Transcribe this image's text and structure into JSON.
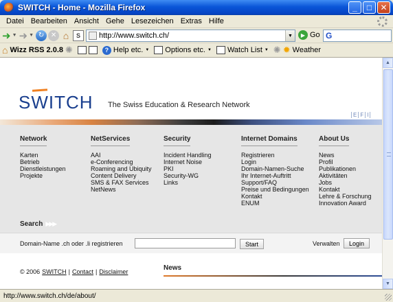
{
  "window": {
    "title": "SWITCH - Home - Mozilla Firefox"
  },
  "menu": [
    "Datei",
    "Bearbeiten",
    "Ansicht",
    "Gehe",
    "Lesezeichen",
    "Extras",
    "Hilfe"
  ],
  "nav": {
    "url": "http://www.switch.ch/",
    "go_label": "Go"
  },
  "toolbar": {
    "wizz_label": "Wizz RSS 2.0.8",
    "help_label": "Help etc.",
    "options_label": "Options etc.",
    "watchlist_label": "Watch List",
    "weather_label": "Weather"
  },
  "page": {
    "logo": "SWITCH",
    "tagline": "The Swiss Education & Research Network",
    "lang": [
      "E",
      "F",
      "I"
    ],
    "columns": [
      {
        "title": "Network",
        "links": [
          "Karten",
          "Betrieb",
          "Dienstleistungen",
          "Projekte"
        ]
      },
      {
        "title": "NetServices",
        "links": [
          "AAI",
          "e-Conferencing",
          "Roaming and Ubiquity",
          "Content Delivery",
          "SMS & FAX Services",
          "NetNews"
        ]
      },
      {
        "title": "Security",
        "links": [
          "Incident Handling",
          "Internet Noise",
          "PKI",
          "Security-WG",
          "Links"
        ]
      },
      {
        "title": "Internet Domains",
        "links": [
          "Registrieren",
          "Login",
          "Domain-Namen-Suche",
          "Ihr Internet-Auftritt",
          "Support/FAQ",
          "Preise und Bedingungen",
          "Kontakt",
          "ENUM"
        ]
      },
      {
        "title": "About Us",
        "links": [
          "News",
          "Profil",
          "Publikationen",
          "Aktivitäten",
          "Jobs",
          "Kontakt",
          "Lehre & Forschung",
          "Innovation Award"
        ]
      }
    ],
    "search_title": "Search",
    "domain_label": "Domain-Name .ch oder .li registrieren",
    "domain_value": "",
    "start_label": "Start",
    "verwalten_label": "Verwalten",
    "login_label": "Login",
    "footer": {
      "copyright": "© 2006",
      "switch": "SWITCH",
      "sep": "|",
      "contact": "Contact",
      "disclaimer": "Disclaimer"
    },
    "news_title": "News"
  },
  "status": {
    "text": "http://www.switch.ch/de/about/"
  }
}
